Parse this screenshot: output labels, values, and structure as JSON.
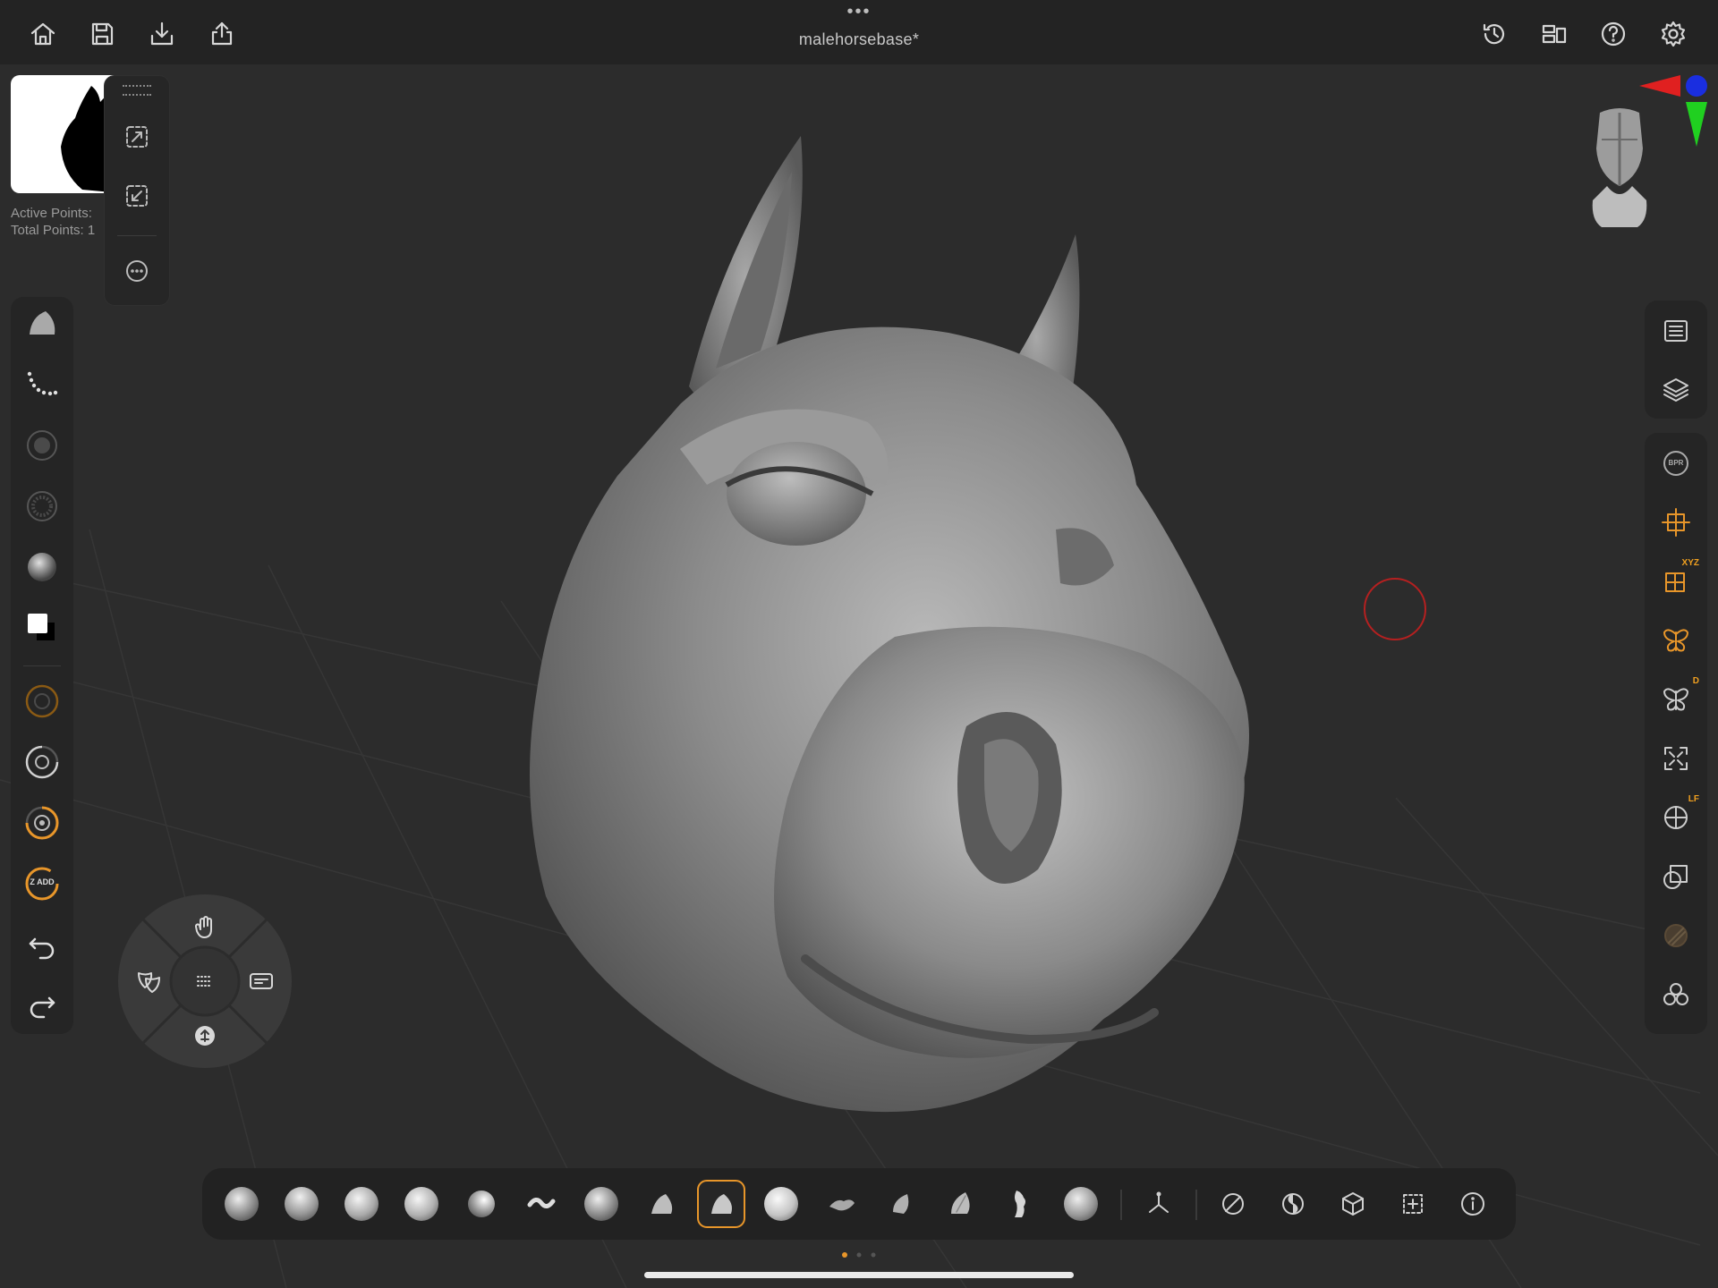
{
  "document": {
    "title": "malehorsebase*"
  },
  "stats": {
    "active_points": "Active Points:",
    "total_points": "Total Points: 1"
  },
  "colors": {
    "accent": "#e8962a",
    "background": "#2c2c2c",
    "panel": "#252525",
    "cursor_ring": "#b52020"
  },
  "topbar": {
    "left_icons": [
      "home-icon",
      "save-icon",
      "import-icon",
      "export-icon"
    ],
    "right_icons": [
      "history-icon",
      "layout-icon",
      "help-icon",
      "settings-icon"
    ]
  },
  "left_toolbar": {
    "items": [
      "brush-icon",
      "stroke-icon",
      "alpha-icon",
      "texture-icon",
      "material-icon",
      "color-swatch",
      "draw-size-icon",
      "focal-shift-icon",
      "z-intensity-icon",
      "zadd-icon",
      "undo-icon",
      "redo-icon"
    ],
    "zadd_label": "Z ADD"
  },
  "right_toolbar": {
    "group1": [
      "list-icon",
      "layers-icon"
    ],
    "group2": [
      "bpr-icon",
      "transform-icon",
      "xyz-grid-icon",
      "symmetry-icon",
      "symmetry-d-icon",
      "frame-icon",
      "local-icon",
      "transpose-icon",
      "polyf-icon",
      "dynamesh-icon"
    ],
    "xyz_badge": "XYZ",
    "d_badge": "D",
    "lf_badge": "LF",
    "bpr_label": "BPR"
  },
  "radial_menu": {
    "items": [
      "gesture-icon",
      "masks-icon",
      "navigate-icon",
      "move-icon",
      "grid-icon"
    ]
  },
  "brush_bar": {
    "active_index": 8,
    "brushes": [
      "clay-buildup-brush",
      "clay-brush",
      "smooth-brush",
      "standard-brush",
      "inflate-brush",
      "dam-standard-brush",
      "curve-brush",
      "trim-brush",
      "move-brush",
      "sphere-brush",
      "flatten-brush",
      "pinch-brush",
      "hpolish-brush",
      "imm-brush",
      "snake-hook-brush"
    ],
    "tools": [
      "gizmo-icon",
      "mask-icon",
      "polygroup-icon",
      "subtool-icon",
      "select-icon",
      "info-icon"
    ]
  }
}
